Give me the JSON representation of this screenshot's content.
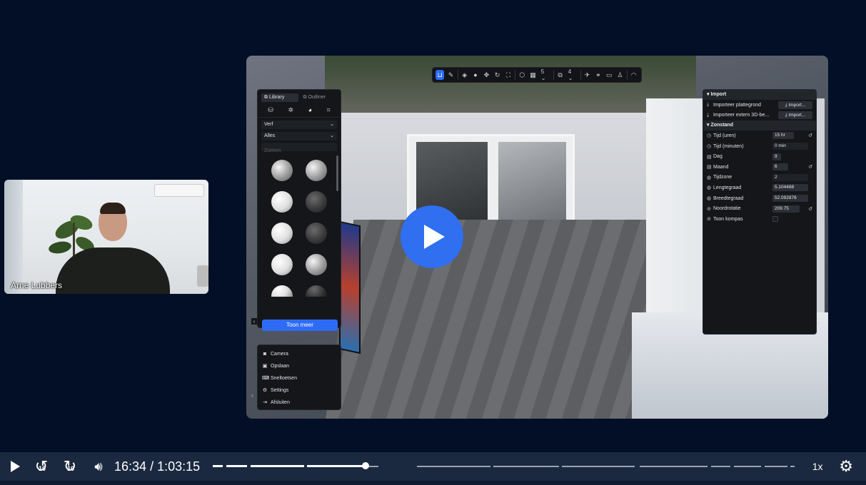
{
  "webcam": {
    "name": "Arne Lubbers"
  },
  "toolbar": {
    "items": [
      "logo",
      "pencil",
      "paint",
      "dot",
      "move",
      "rotate",
      "scale",
      "cube",
      "grid",
      "num5",
      "frame",
      "num4",
      "plane",
      "link",
      "box",
      "figure",
      "sun"
    ],
    "num1": "5",
    "num2": "4"
  },
  "library_panel": {
    "tabs": [
      "Library",
      "Outliner"
    ],
    "category_icons": [
      "box-icon",
      "plant-icon",
      "palette-icon",
      "frame-icon"
    ],
    "filter1": "Verf",
    "filter2": "Alles",
    "search_placeholder": "Zoeken",
    "materials": [
      "grey",
      "grey",
      "white",
      "dark",
      "white",
      "dark",
      "white",
      "grey",
      "white",
      "dark"
    ],
    "show_more": "Toon meer"
  },
  "menu": {
    "items": [
      {
        "icon": "camera-icon",
        "label": "Camera"
      },
      {
        "icon": "save-icon",
        "label": "Opslaan"
      },
      {
        "icon": "keyboard-icon",
        "label": "Sneltoetsen"
      },
      {
        "icon": "gear-icon",
        "label": "Settings"
      },
      {
        "icon": "exit-icon",
        "label": "Afsluiten"
      }
    ]
  },
  "props_panel": {
    "import_section": "Import",
    "import_rows": [
      {
        "label": "Importeer plattegrond",
        "button": "Import..."
      },
      {
        "label": "Importeer extern 3D-be...",
        "button": "Import..."
      }
    ],
    "sun_section": "Zonstand",
    "sun_rows": [
      {
        "label": "Tijd (uren)",
        "value": "15 hr"
      },
      {
        "label": "Tijd (minuten)",
        "value": "0 min"
      },
      {
        "label": "Dag",
        "value": "9"
      },
      {
        "label": "Maand",
        "value": "6"
      },
      {
        "label": "Tijdzone",
        "value": "2"
      },
      {
        "label": "Lengtegraad",
        "value": "5.104488"
      },
      {
        "label": "Breedtegraad",
        "value": "52.092876"
      },
      {
        "label": "Noordrotatie",
        "value": "209.75"
      },
      {
        "label": "Toon kompas",
        "value": ""
      }
    ]
  },
  "player": {
    "current_time": "16:34",
    "separator": "/",
    "duration": "1:03:15",
    "progress_fraction": 0.262,
    "skip_back_label": "10",
    "skip_fwd_label": "10",
    "speed": "1x",
    "accent": "#2f6ff0"
  }
}
